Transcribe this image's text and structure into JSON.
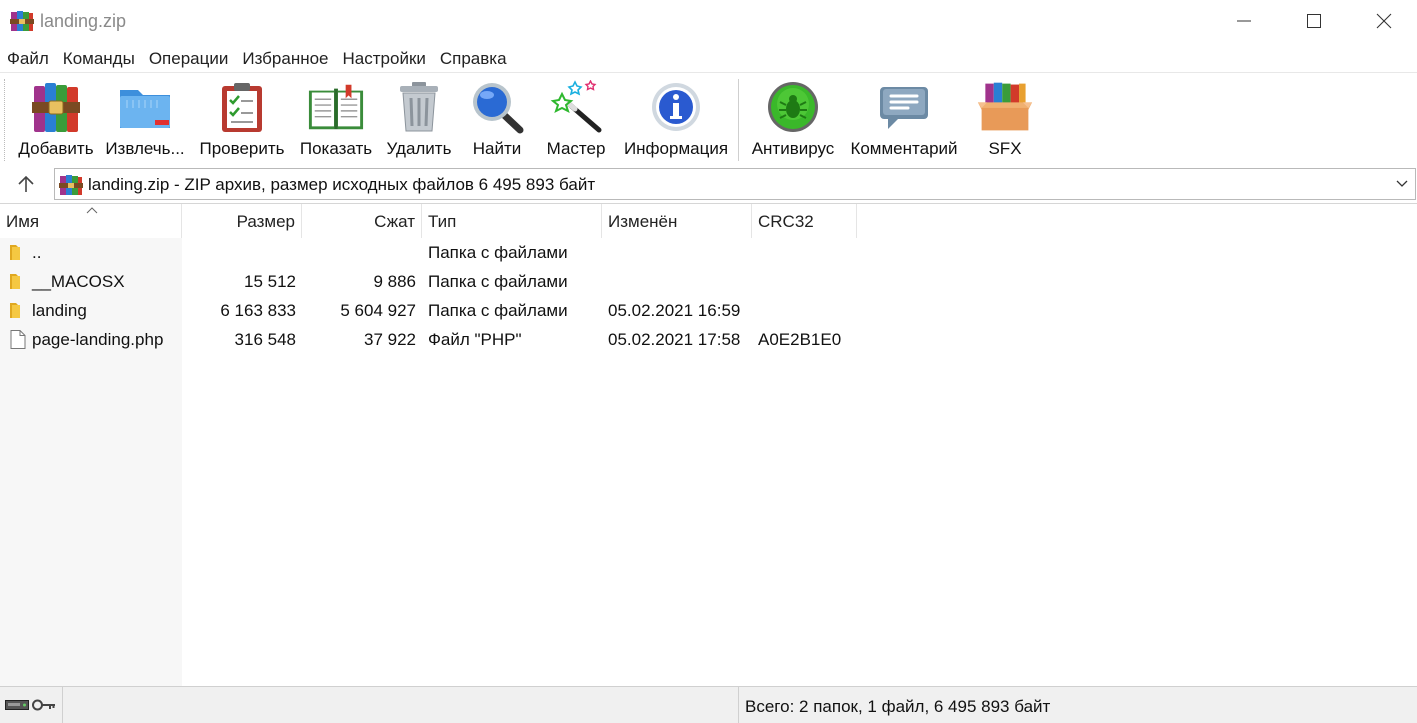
{
  "window": {
    "title": "landing.zip",
    "app_icon": "winrar-books-icon",
    "controls": [
      "minimize-icon",
      "maximize-icon",
      "close-icon"
    ]
  },
  "menu": {
    "items": [
      "Файл",
      "Команды",
      "Операции",
      "Избранное",
      "Настройки",
      "Справка"
    ]
  },
  "toolbar": {
    "buttons": [
      {
        "label": "Добавить",
        "icon": "add-archive-icon"
      },
      {
        "label": "Извлечь...",
        "icon": "extract-folder-icon"
      },
      {
        "label": "Проверить",
        "icon": "test-clipboard-icon"
      },
      {
        "label": "Показать",
        "icon": "view-book-icon"
      },
      {
        "label": "Удалить",
        "icon": "trash-icon"
      },
      {
        "label": "Найти",
        "icon": "find-magnifier-icon"
      },
      {
        "label": "Мастер",
        "icon": "wizard-wand-icon"
      },
      {
        "label": "Информация",
        "icon": "info-icon"
      },
      {
        "label": "Антивирус",
        "icon": "antivirus-bug-icon"
      },
      {
        "label": "Комментарий",
        "icon": "comment-icon"
      },
      {
        "label": "SFX",
        "icon": "sfx-box-icon"
      }
    ]
  },
  "address": {
    "text": "landing.zip - ZIP архив, размер исходных файлов 6 495 893 байт",
    "icon": "winrar-books-icon"
  },
  "columns": {
    "name": "Имя",
    "size": "Размер",
    "packed": "Сжат",
    "type": "Тип",
    "modified": "Изменён",
    "crc": "CRC32"
  },
  "files": [
    {
      "name": "..",
      "size": "",
      "packed": "",
      "type": "Папка с файлами",
      "modified": "",
      "crc": "",
      "icon": "folder-icon"
    },
    {
      "name": "__MACOSX",
      "size": "15 512",
      "packed": "9 886",
      "type": "Папка с файлами",
      "modified": "",
      "crc": "",
      "icon": "folder-icon"
    },
    {
      "name": "landing",
      "size": "6 163 833",
      "packed": "5 604 927",
      "type": "Папка с файлами",
      "modified": "05.02.2021 16:59",
      "crc": "",
      "icon": "folder-icon"
    },
    {
      "name": "page-landing.php",
      "size": "316 548",
      "packed": "37 922",
      "type": "Файл \"PHP\"",
      "modified": "05.02.2021 17:58",
      "crc": "A0E2B1E0",
      "icon": "file-icon"
    }
  ],
  "status": {
    "text": "Всего: 2 папок, 1 файл, 6 495 893 байт",
    "left_icons": [
      "drive-icon",
      "key-icon"
    ]
  },
  "colors": {
    "title_gray": "#8a8a8a",
    "folder_yellow": "#f5c842",
    "status_bg": "#f0f0f0",
    "name_column_bg": "#f7f7f7"
  }
}
